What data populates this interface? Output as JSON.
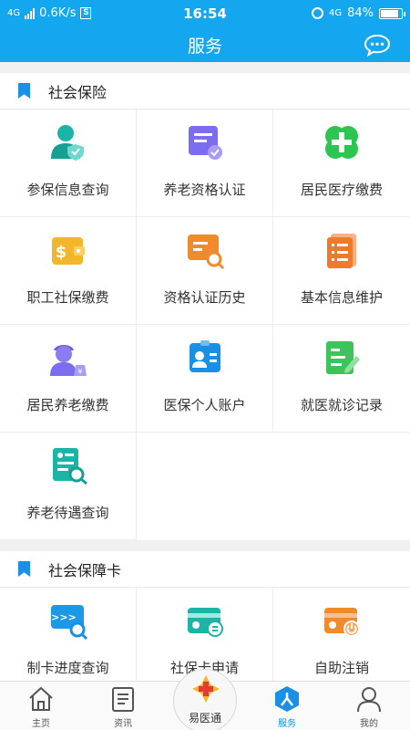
{
  "status_bar": {
    "network": "4G",
    "speed": "0.6K/s",
    "sim_icon": "S",
    "time": "16:54",
    "network_right": "4G",
    "battery": "84%"
  },
  "header": {
    "title": "服务",
    "chat_icon": "chat-bubble-icon"
  },
  "section_social_insurance": {
    "title": "社会保险",
    "items": [
      {
        "label": "参保信息查询",
        "icon": "person-shield-icon"
      },
      {
        "label": "养老资格认证",
        "icon": "document-badge-icon"
      },
      {
        "label": "居民医疗缴费",
        "icon": "medical-cross-icon"
      },
      {
        "label": "职工社保缴费",
        "icon": "wallet-dollar-icon"
      },
      {
        "label": "资格认证历史",
        "icon": "card-search-icon"
      },
      {
        "label": "基本信息维护",
        "icon": "document-list-icon"
      },
      {
        "label": "居民养老缴费",
        "icon": "elder-money-icon"
      },
      {
        "label": "医保个人账户",
        "icon": "id-card-icon"
      },
      {
        "label": "就医就诊记录",
        "icon": "document-edit-icon"
      },
      {
        "label": "养老待遇查询",
        "icon": "document-magnifier-icon"
      }
    ]
  },
  "section_social_card": {
    "title": "社会保障卡",
    "items": [
      {
        "label": "制卡进度查询",
        "icon": "card-progress-search-icon"
      },
      {
        "label": "社保卡申请",
        "icon": "card-apply-icon"
      },
      {
        "label": "自助注销",
        "icon": "card-power-icon"
      }
    ]
  },
  "bottom_nav": {
    "items": [
      {
        "label": "主页",
        "icon": "home-icon"
      },
      {
        "label": "资讯",
        "icon": "news-icon"
      },
      {
        "label": "易医通",
        "icon": "medical-logo-icon"
      },
      {
        "label": "服务",
        "icon": "service-person-icon",
        "active": true
      },
      {
        "label": "我的",
        "icon": "user-icon"
      }
    ]
  },
  "colors": {
    "primary": "#15a6f0",
    "accent_blue": "#1a8fe6",
    "teal": "#1bb5a8",
    "purple": "#7b6cf0",
    "green": "#2ec451",
    "yellow": "#f3b62a",
    "orange": "#f08a2a"
  }
}
